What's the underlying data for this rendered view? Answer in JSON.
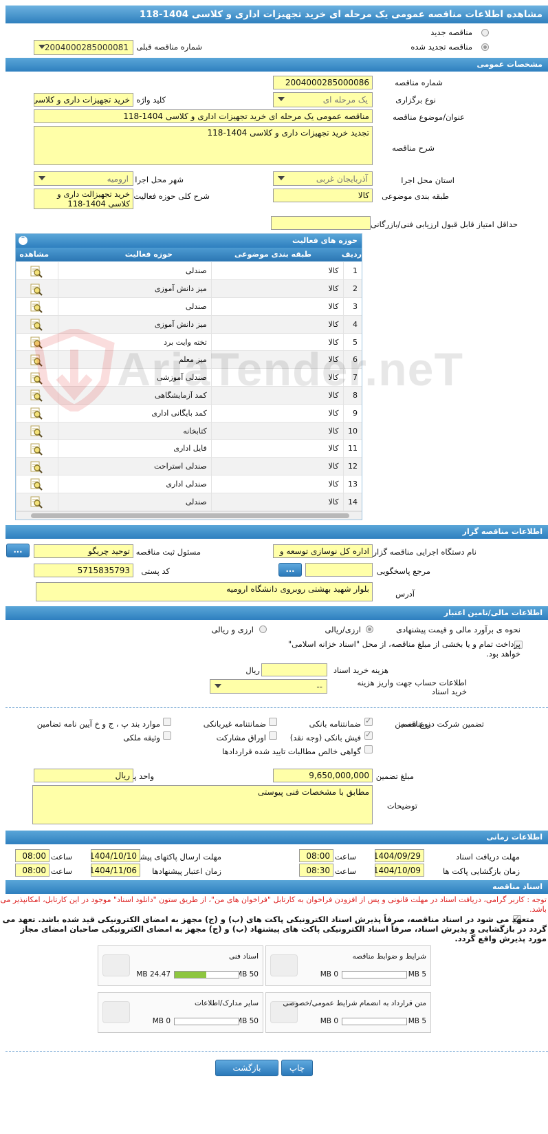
{
  "page_title": "مشاهده اطلاعات مناقصه عمومی یک مرحله ای خرید تجهیزات اداری و کلاسی 1404-118",
  "tender_type": {
    "new_label": "مناقصه جدید",
    "renewed_label": "مناقصه تجدید شده",
    "prev_number_label": "شماره مناقصه قبلی",
    "prev_number_value": "2004000285000081"
  },
  "general": {
    "header": "مشخصات عمومی",
    "number_label": "شماره مناقصه",
    "number_value": "2004000285000086",
    "method_label": "نوع برگزاری",
    "method_value": "یک مرحله ای",
    "keyword_label": "کلید واژه",
    "keyword_value": "خرید تجهیزات داری و کلاسی",
    "subject_label": "عنوان/موضوع مناقصه",
    "subject_value": "مناقصه عمومی یک مرحله ای خرید تجهیزات اداری و کلاسی 1404-118",
    "desc_label": "شرح مناقصه",
    "desc_value": "تجدید خرید تجهیزات داری و کلاسی 1404-118",
    "province_label": "استان محل اجرا",
    "province_value": "آذربایجان غربی",
    "city_label": "شهر محل اجرا",
    "city_value": "ارومیه",
    "category_label": "طبقه بندی موضوعی",
    "category_value": "کالا",
    "activity_desc_label": "شرح کلی حوزه فعالیت",
    "activity_desc_value": "خرید تجهیزالت داری و کلاسی 1404-118",
    "min_score_label": "حداقل امتیاز قابل قبول ارزیابی فنی/بازرگانی",
    "min_score_value": ""
  },
  "activity": {
    "header": "حوزه های فعالیت",
    "col_row": "ردیف",
    "col_category": "طبقه بندی موضوعی",
    "col_field": "حوزه فعالیت",
    "col_view": "مشاهده",
    "rows": [
      [
        "1",
        "کالا",
        "صندلی"
      ],
      [
        "2",
        "کالا",
        "میز دانش آموزی"
      ],
      [
        "3",
        "کالا",
        "صندلی"
      ],
      [
        "4",
        "کالا",
        "میز دانش آموزی"
      ],
      [
        "5",
        "کالا",
        "تخته وایت برد"
      ],
      [
        "6",
        "کالا",
        "میز معلم"
      ],
      [
        "7",
        "کالا",
        "صندلی آموزشی"
      ],
      [
        "8",
        "کالا",
        "کمد آزمایشگاهی"
      ],
      [
        "9",
        "کالا",
        "کمد بایگانی اداری"
      ],
      [
        "10",
        "کالا",
        "کتابخانه"
      ],
      [
        "11",
        "کالا",
        "فایل اداری"
      ],
      [
        "12",
        "کالا",
        "صندلی استراحت"
      ],
      [
        "13",
        "کالا",
        "صندلی اداری"
      ],
      [
        "14",
        "کالا",
        "صندلی"
      ]
    ]
  },
  "organizer": {
    "header": "اطلاعات مناقصه گزار",
    "org_label": "نام دستگاه اجرایی مناقصه گزار",
    "org_value": "اداره کل نوسازی   توسعه و",
    "registrar_label": "مسئول ثبت مناقصه",
    "registrar_value": "توحید چریگو",
    "ref_label": "مرجع پاسخگویی",
    "ref_value": "",
    "postal_label": "کد پستی",
    "postal_value": "5715835793",
    "address_label": "آدرس",
    "address_value": "بلوار شهید بهشتی روبروی دانشگاه ارومیه",
    "more_btn": "..."
  },
  "finance": {
    "header": "اطلاعات مالی/تامین اعتبار",
    "estimate_label": "نحوه ی برآورد مالی و قیمت پیشنهادی",
    "opt1": "ارزی/ریالی",
    "opt2": "ارزی و ریالی",
    "treasury_text": "پرداخت تمام و یا بخشی از مبلغ مناقصه، از محل \"اسناد خزانه اسلامی\" خواهد بود.",
    "doc_cost_label": "هزینه خرید اسناد",
    "doc_cost_value": "",
    "doc_cost_unit": "ریال",
    "account_label": "اطلاعات حساب جهت واریز هزینه خرید اسناد",
    "account_value": "--"
  },
  "guarantee": {
    "section_label": "تضمین شرکت در مناقصه:",
    "type_label": "نوع تضمین",
    "items": [
      "ضمانتنامه بانکی",
      "ضمانتنامه غیربانکی",
      "موارد بند پ ، ج و خ آیین نامه تضامین",
      "فیش بانکی (وجه نقد)",
      "اوراق مشارکت",
      "وثیقه ملکی",
      "گواهی خالص مطالبات تایید شده قراردادها"
    ],
    "amount_label": "مبلغ تضمین",
    "amount_value": "9,650,000,000",
    "currency_label": "واحد پول",
    "currency_value": "ریال",
    "notes_label": "توضیحات",
    "notes_value": "مطابق با مشخصات فنی پیوستی"
  },
  "timing": {
    "header": "اطلاعات زمانی",
    "receive_label": "مهلت دریافت اسناد",
    "receive_date": "1404/09/29",
    "receive_time": "08:00",
    "send_label": "مهلت ارسال پاکتهای پیشنهادها",
    "send_date": "1404/10/10",
    "send_time": "08:00",
    "open_label": "زمان بازگشایی پاکت ها",
    "open_date": "1404/10/09",
    "open_time": "08:30",
    "validity_label": "زمان اعتبار پیشنهادها",
    "validity_date": "1404/11/06",
    "validity_time": "08:00",
    "time_label": "ساعت"
  },
  "documents": {
    "header": "اسناد مناقصه",
    "notice": "توجه : کاربر گرامی، دریافت اسناد در مهلت قانونی و پس از افزودن فراخوان به کارتابل \"فراخوان های من\"، از طریق ستون \"دانلود اسناد\" موجود در این کارتابل، امکانپذیر می باشد.",
    "commitment": "متعهد می شود در اسناد مناقصه، صرفاً پذیرش اسناد الکترونیکی پاکت های (ب) و (ج) مجهز به امضای الکترونیکی قید شده باشد. تعهد می گردد در بازگشایی و پذیرش اسناد، صرفاً اسناد الکترونیکی پاکت های پیشنهاد (ب) و (ج) مجهز به امضای الکترونیکی صاحبان امضای مجاز مورد پذیرش واقع گردد.",
    "files": [
      {
        "name": "شرایط و ضوابط مناقصه",
        "used": "0 MB",
        "max": "5 MB",
        "fill": 0
      },
      {
        "name": "اسناد فنی",
        "used": "24.47 MB",
        "max": "50 MB",
        "fill": 0.49
      },
      {
        "name": "متن قرارداد به انضمام شرایط عمومی/خصوصی",
        "used": "0 MB",
        "max": "5 MB",
        "fill": 0
      },
      {
        "name": "سایر مدارک/اطلاعات",
        "used": "0 MB",
        "max": "50 MB",
        "fill": 0
      }
    ]
  },
  "buttons": {
    "back": "بازگشت",
    "print": "چاپ"
  },
  "watermark": "AriaTender.neT"
}
